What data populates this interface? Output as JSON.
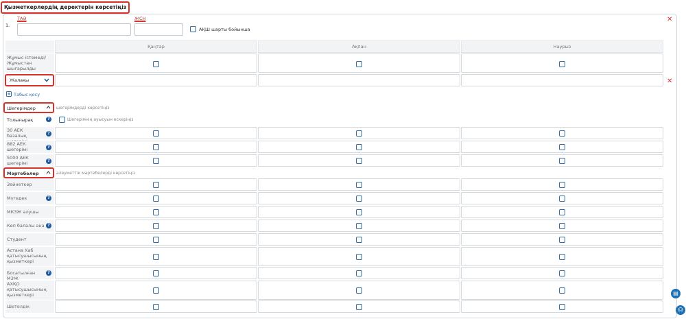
{
  "page_title": "Қызметкерлердің деректерін көрсетіңіз",
  "row_number": "1.",
  "fields": {
    "tao_label": "ТАӘ",
    "tao_value": "",
    "zhsn_label": "ЖСН",
    "zhsn_value": "",
    "usa_checkbox_label": "АҚШ шарты бойынша"
  },
  "months": [
    "Қаңтар",
    "Ақпан",
    "Наурыз"
  ],
  "not_working_label": "Жұмыс істемеді/ Жұмыстан шығарылды",
  "income_select": {
    "value": "Жалақы"
  },
  "add_income_label": "Табыс қосу",
  "deductions": {
    "toggle_label": "Шегерімдер",
    "hint": "шегерімдерді көрсетіңіз",
    "full_label": "Толығырақ",
    "remainder_checkbox_label": "Шегерімнің ауысуын ескеріңіз",
    "rows": [
      {
        "label": "30 АЕК базалық шегерімі",
        "help": true
      },
      {
        "label": "882 АЕК шегерімі",
        "help": true
      },
      {
        "label": "5000 АЕК шегерімі",
        "help": true
      }
    ]
  },
  "statuses": {
    "toggle_label": "Мәртебелер",
    "hint": "әлеуметтік мәртебелерді көрсетіңіз",
    "rows": [
      {
        "label": "Зейнеткер",
        "help": false
      },
      {
        "label": "Мүгедек",
        "help": true
      },
      {
        "label": "МКЗЖ алушы",
        "help": false
      },
      {
        "label": "Көп балалы ана",
        "help": true
      },
      {
        "label": "Студент",
        "help": false
      },
      {
        "label": "Астана Хаб қатысушысының қызметкері",
        "help": false
      },
      {
        "label": "Босатылған МЗЖ",
        "help": true
      },
      {
        "label": "АХҚО қатысушысының қызметкері",
        "help": false
      },
      {
        "label": "Шетелдік",
        "help": false
      }
    ]
  },
  "icons": {
    "close": "close-icon",
    "chevron_down": "chevron-down-icon",
    "chevron_up": "chevron-up-icon",
    "help": "question-icon",
    "plus": "plus-icon",
    "book": "book-icon",
    "support": "headset-icon"
  },
  "colors": {
    "accent": "#2e6da4",
    "highlight": "#d9302b",
    "help_badge": "#1e5aa0"
  }
}
